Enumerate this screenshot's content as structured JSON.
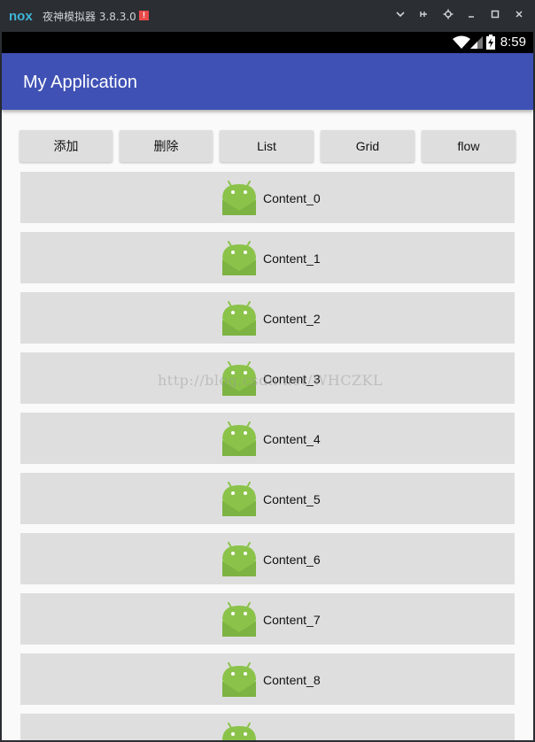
{
  "emulator": {
    "title": "夜神模拟器 3.8.3.0",
    "warning_badge": "!",
    "controls": [
      "chevron-down-icon",
      "pin-icon",
      "gear-icon",
      "minimize-icon",
      "maximize-icon",
      "close-icon"
    ]
  },
  "status_bar": {
    "time": "8:59"
  },
  "app_bar": {
    "title": "My Application",
    "color": "#3f51b5"
  },
  "buttons": [
    {
      "label": "添加"
    },
    {
      "label": "删除"
    },
    {
      "label": "List"
    },
    {
      "label": "Grid"
    },
    {
      "label": "flow"
    }
  ],
  "list": {
    "items": [
      {
        "label": "Content_0"
      },
      {
        "label": "Content_1"
      },
      {
        "label": "Content_2"
      },
      {
        "label": "Content_3"
      },
      {
        "label": "Content_4"
      },
      {
        "label": "Content_5"
      },
      {
        "label": "Content_6"
      },
      {
        "label": "Content_7"
      },
      {
        "label": "Content_8"
      },
      {
        "label": ""
      }
    ]
  },
  "watermark": "http://blog.csdn.net/WHCZKL"
}
